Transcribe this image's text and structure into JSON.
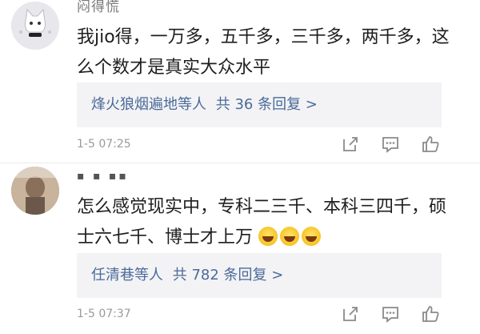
{
  "comments": [
    {
      "username": "闷得慌",
      "text": "我jio得，一万多，五千多，三千多，两千多，这么个数才是真实大众水平",
      "replies": {
        "names": "烽火狼烟遍地",
        "suffix": "等人",
        "count": "共 36 条回复 >"
      },
      "time": "1-5 07:25"
    },
    {
      "username": "▪ ▪ ▪▪",
      "text": "怎么感觉现实中，专科二三千、本科三四千，硕士六七千、博士才上万",
      "replies": {
        "names": "任清巷",
        "suffix": "等人",
        "count": "共 782 条回复 >"
      },
      "time": "1-5 07:37"
    }
  ],
  "icons": {
    "share": "share-icon",
    "comment": "comment-icon",
    "like": "like-icon"
  },
  "colors": {
    "link": "#4a6a9a",
    "meta": "#9a9a9a",
    "reply_bg": "#f3f3f5"
  }
}
